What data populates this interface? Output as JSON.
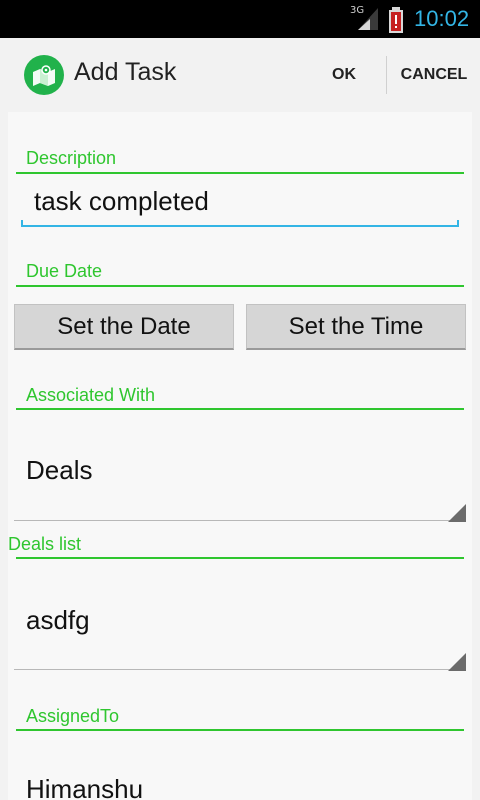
{
  "status_bar": {
    "network": "3G",
    "time": "10:02",
    "icons": [
      "signal-icon",
      "battery-alert-icon"
    ]
  },
  "action_bar": {
    "title": "Add Task",
    "ok_label": "OK",
    "cancel_label": "CANCEL",
    "icon": "map-pin-icon"
  },
  "form": {
    "description": {
      "label": "Description",
      "value": "task completed"
    },
    "due_date": {
      "label": "Due Date",
      "set_date_label": "Set the Date",
      "set_time_label": "Set the Time"
    },
    "associated_with": {
      "label": "Associated With",
      "value": "Deals"
    },
    "deals_list": {
      "label": "Deals list",
      "value": "asdfg"
    },
    "assigned_to": {
      "label": "AssignedTo",
      "value": "Himanshu"
    }
  },
  "colors": {
    "accent_green": "#2fc62f",
    "focus_blue": "#33b5e5",
    "app_icon_green": "#21b24b"
  }
}
